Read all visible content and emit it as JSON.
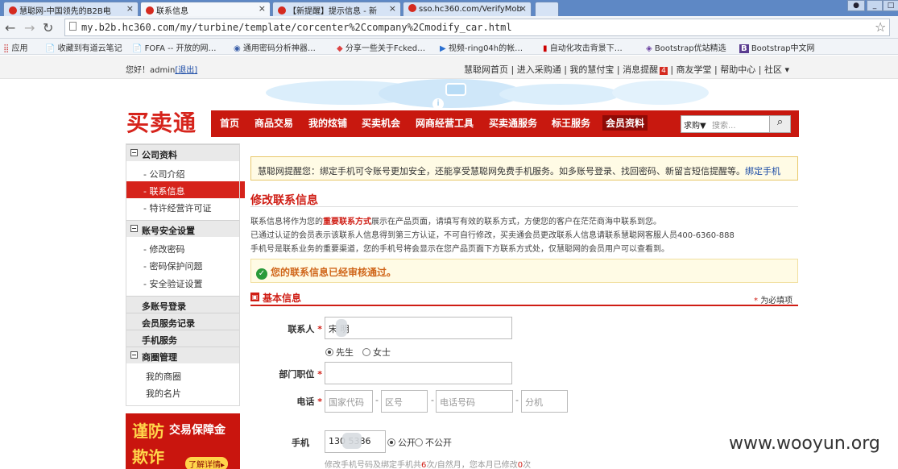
{
  "browser": {
    "tabs": [
      {
        "title": "慧聪网-中国领先的B2B电"
      },
      {
        "title": "联系信息"
      },
      {
        "title": "【新提醒】提示信息 - 新"
      },
      {
        "title": "sso.hc360.com/VerifyMob"
      }
    ],
    "url": "my.b2b.hc360.com/my/turbine/template/corcenter%2Ccompany%2Cmodify_car.html",
    "bookmarks": [
      "应用",
      "收藏到有道云笔记",
      "FOFA -- 开放的网…",
      "通用密码分析神器…",
      "分享一些关于Fcked…",
      "视频-ring04h的帐…",
      "自动化攻击背景下…",
      "Bootstrap优站精选",
      "Bootstrap中文网"
    ]
  },
  "topbar": {
    "greeting": "您好！admin",
    "logout": "[退出]",
    "links": [
      "慧聪网首页",
      "进入采购通",
      "我的慧付宝",
      "消息提醒",
      "商友学堂",
      "帮助中心",
      "社区"
    ],
    "badge": "4"
  },
  "header": {
    "logo": "买卖通",
    "nav": [
      "首页",
      "商品交易",
      "我的炫铺",
      "买卖机会",
      "网商经营工具",
      "买卖通服务",
      "标王服务",
      "会员资料"
    ],
    "search_type": "求购▼",
    "search_placeholder": "搜索..."
  },
  "sidebar": {
    "company_title": "公司资料",
    "company_items": [
      "公司介绍",
      "联系信息",
      "特许经营许可证"
    ],
    "security_title": "账号安全设置",
    "security_items": [
      "修改密码",
      "密码保护问题",
      "安全验证设置"
    ],
    "multi_login": "多账号登录",
    "service_record": "会员服务记录",
    "mobile_service": "手机服务",
    "shop_title": "商圈管理",
    "shop_items": [
      "我的商圈",
      "我的名片"
    ],
    "ad_line1": "谨防",
    "ad_line2": "交易保障金",
    "ad_line3": "欺诈",
    "ad_link": "了解详情"
  },
  "main": {
    "notice_text": "慧聪网提醒您：绑定手机可令账号更加安全，还能享受慧聪网免费手机服务。如多账号登录、找回密码、新留言短信提醒等。",
    "notice_link": "绑定手机",
    "title": "修改联系信息",
    "para1_a": "联系信息将作为您的",
    "para1_b": "重要联系方式",
    "para1_c": "展示在产品页面，请填写有效的联系方式，方便您的客户在茫茫商海中联系到您。",
    "para2": "已通过认证的会员表示该联系人信息得到第三方认证，不可自行修改，买卖通会员更改联系人信息请联系慧聪网客服人员400-6360-888",
    "para3": "手机号是联系业务的重要渠道，您的手机号将会显示在您产品页面下方联系方式处，仅慧聪网的会员用户可以查看到。",
    "ok_text": "您的联系信息已经审核通过。",
    "basic_title": "基本信息",
    "required_note": "为必填项",
    "contact_label": "联系人",
    "contact_value": "宋  明",
    "gender_male": "先生",
    "gender_female": "女士",
    "dept_label": "部门职位",
    "phone_label": "电话",
    "ph_country": "国家代码",
    "ph_area": "区号",
    "ph_number": "电话号码",
    "ph_ext": "分机",
    "mobile_label": "手机",
    "mobile_value": "130        5386",
    "public": "公开",
    "private": "不公开",
    "mobile_note_a": "修改手机号码及绑定手机共",
    "mobile_note_b": "6",
    "mobile_note_c": "次/自然月，您本月已修改",
    "mobile_note_d": "0",
    "mobile_note_e": "次"
  },
  "watermark": "www.wooyun.org",
  "colors": {
    "brand_red": "#c8180f",
    "notice_bg": "#fffbe5",
    "ok_green": "#2a9a3a"
  }
}
